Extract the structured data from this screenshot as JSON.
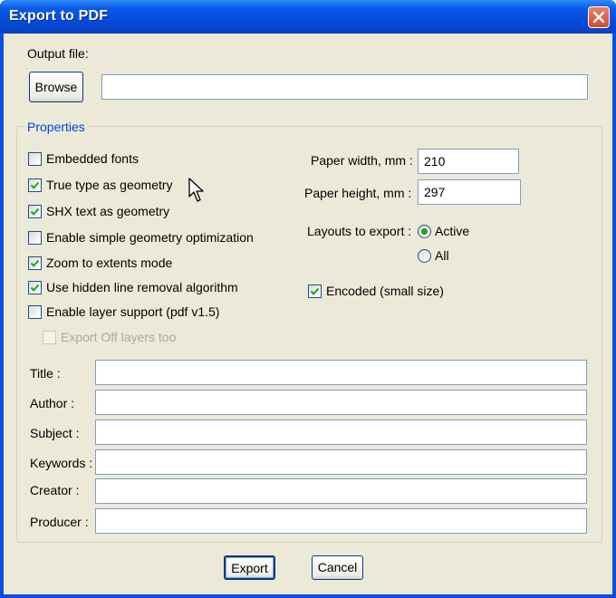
{
  "window": {
    "title": "Export to PDF"
  },
  "output": {
    "label": "Output file:",
    "browse_label": "Browse",
    "path_value": ""
  },
  "properties": {
    "legend": "Properties",
    "checkboxes": [
      {
        "label": "Embedded fonts",
        "checked": false
      },
      {
        "label": "True type as geometry",
        "checked": true
      },
      {
        "label": "SHX text as geometry",
        "checked": true
      },
      {
        "label": "Enable simple geometry optimization",
        "checked": false
      },
      {
        "label": "Zoom to extents mode",
        "checked": true
      },
      {
        "label": "Use hidden line removal algorithm",
        "checked": true
      },
      {
        "label": "Enable layer support (pdf v1.5)",
        "checked": false
      },
      {
        "label": "Export Off layers too",
        "checked": false,
        "disabled": true
      }
    ],
    "paper_width_label": "Paper width, mm :",
    "paper_width_value": "210",
    "paper_height_label": "Paper height, mm :",
    "paper_height_value": "297",
    "layouts_label": "Layouts to export :",
    "layouts_options": [
      {
        "label": "Active",
        "selected": true
      },
      {
        "label": "All",
        "selected": false
      }
    ],
    "encoded_label": "Encoded (small size)",
    "encoded_checked": true
  },
  "meta_fields": [
    {
      "label": "Title :",
      "value": ""
    },
    {
      "label": "Author :",
      "value": ""
    },
    {
      "label": "Subject :",
      "value": ""
    },
    {
      "label": "Keywords :",
      "value": ""
    },
    {
      "label": "Creator :",
      "value": ""
    },
    {
      "label": "Producer :",
      "value": ""
    }
  ],
  "buttons": {
    "export_label": "Export",
    "cancel_label": "Cancel"
  },
  "colors": {
    "titlebar": "#0548d8",
    "dialog_bg": "#ece9d8",
    "legend_text": "#0046d5",
    "check_green": "#21a121",
    "close_red": "#d24a2a"
  }
}
